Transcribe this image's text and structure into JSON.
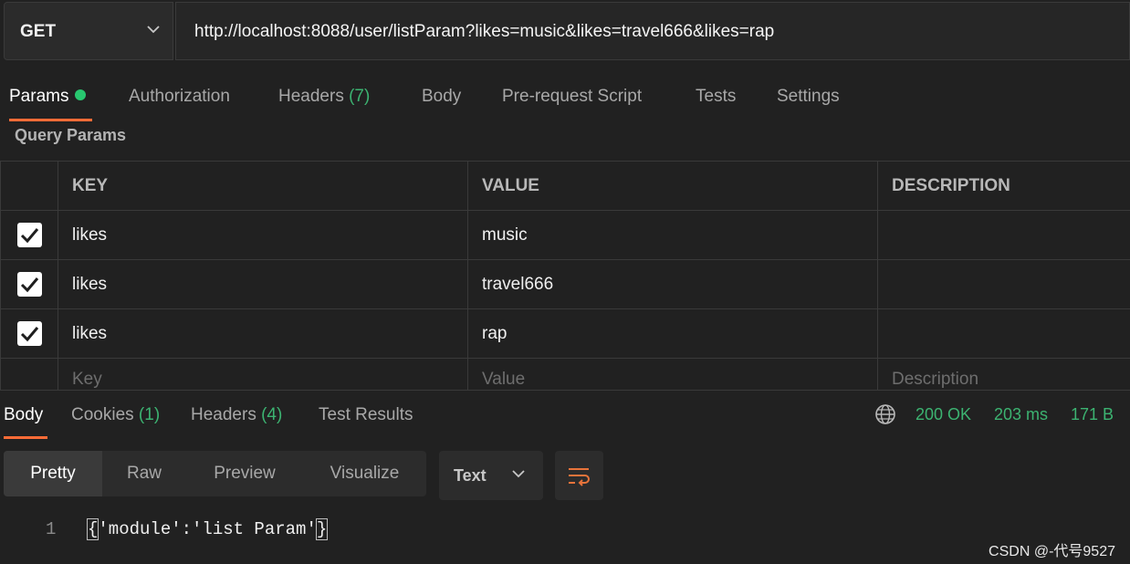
{
  "request": {
    "method": "GET",
    "url": "http://localhost:8088/user/listParam?likes=music&likes=travel666&likes=rap"
  },
  "tabs": [
    {
      "label": "Params",
      "count": ""
    },
    {
      "label": "Authorization",
      "count": ""
    },
    {
      "label": "Headers ",
      "count": "(7)"
    },
    {
      "label": "Body",
      "count": ""
    },
    {
      "label": "Pre-request Script",
      "count": ""
    },
    {
      "label": "Tests",
      "count": ""
    },
    {
      "label": "Settings",
      "count": ""
    }
  ],
  "query_params": {
    "title": "Query Params",
    "headers": {
      "key": "KEY",
      "value": "VALUE",
      "description": "DESCRIPTION"
    },
    "rows": [
      {
        "key": "likes",
        "value": "music",
        "description": "",
        "checked": true
      },
      {
        "key": "likes",
        "value": "travel666",
        "description": "",
        "checked": true
      },
      {
        "key": "likes",
        "value": "rap",
        "description": "",
        "checked": true
      }
    ],
    "placeholders": {
      "key": "Key",
      "value": "Value",
      "description": "Description"
    }
  },
  "response": {
    "tabs": [
      {
        "label": "Body",
        "count": ""
      },
      {
        "label": "Cookies ",
        "count": "(1)"
      },
      {
        "label": "Headers ",
        "count": "(4)"
      },
      {
        "label": "Test Results",
        "count": ""
      }
    ],
    "status": "200 OK",
    "time": "203 ms",
    "size": "171 B",
    "views": [
      "Pretty",
      "Raw",
      "Preview",
      "Visualize"
    ],
    "format": "Text",
    "line_number": "1",
    "body_open": "{",
    "body_text": "'module':'list Param'",
    "body_close": "}"
  },
  "watermark": "CSDN @-代号9527",
  "colors": {
    "accent": "#ff6c37",
    "success": "#3cb371",
    "background": "#212121"
  }
}
